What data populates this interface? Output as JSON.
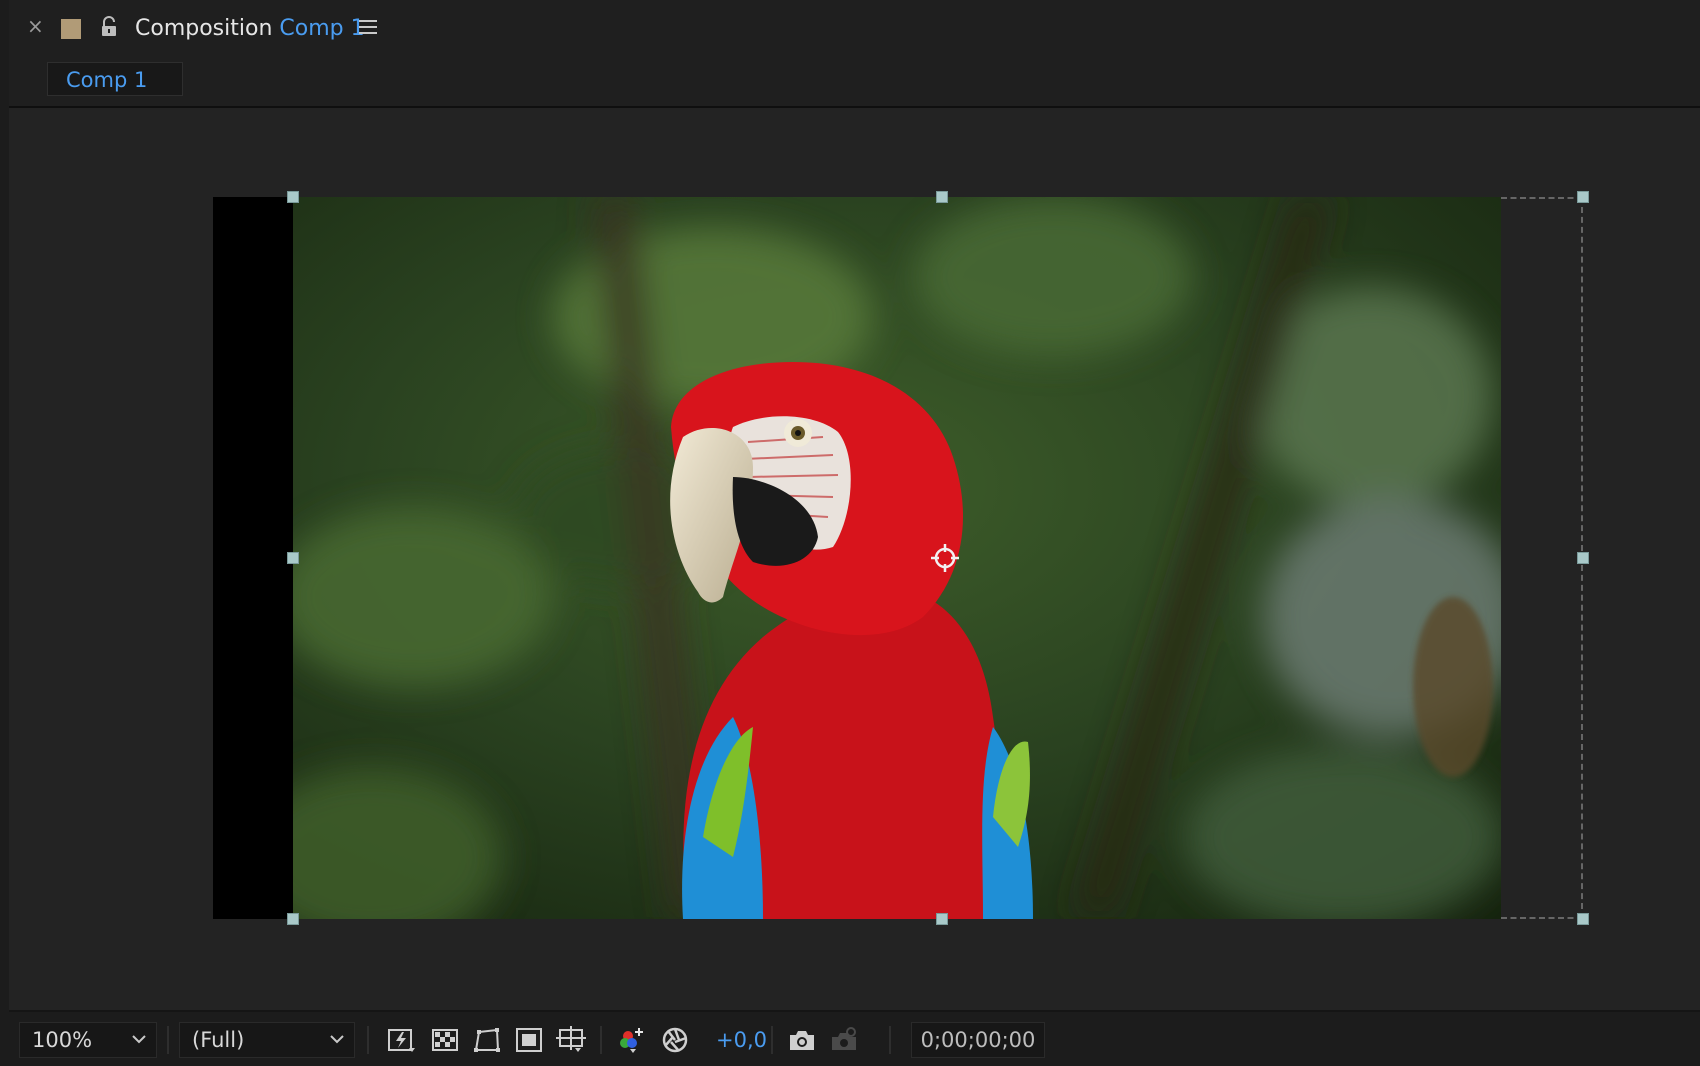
{
  "panel": {
    "title_prefix": "Composition",
    "title_comp": "Comp 1",
    "tab_label": "Comp 1"
  },
  "colors": {
    "label_swatch": "#b19b77",
    "accent": "#4a9cf0",
    "handle": "#a9c9c9"
  },
  "icons": {
    "close": "close-icon",
    "lock": "lock-icon",
    "menu": "hamburger-menu-icon"
  },
  "toolbar": {
    "zoom": "100%",
    "resolution": "(Full)",
    "exposure": "+0,0",
    "timecode": "0;00;00;00"
  }
}
